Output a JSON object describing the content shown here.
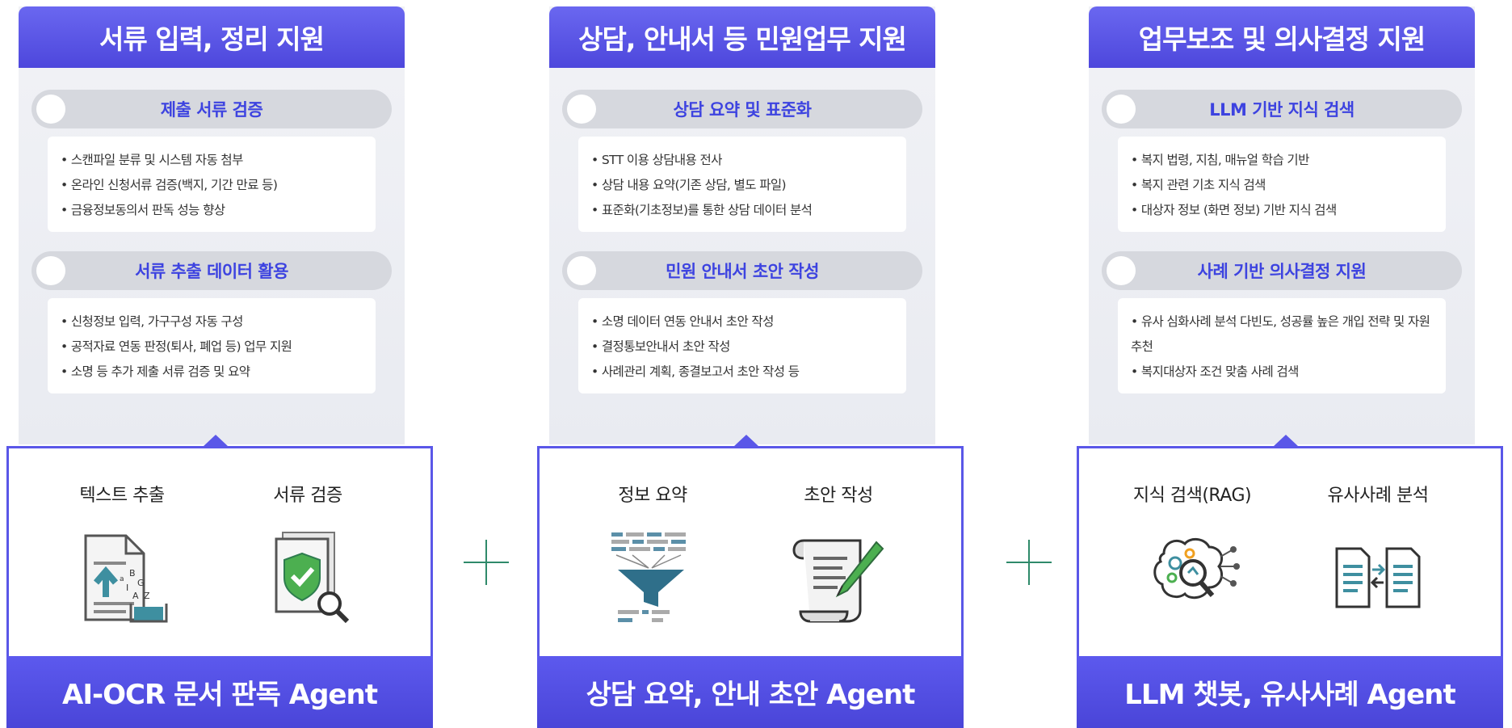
{
  "columns": [
    {
      "top_title": "서류 입력, 정리 지원",
      "sections": [
        {
          "title": "제출 서류 검증",
          "bullets": [
            "스캔파일 분류 및 시스템 자동 첨부",
            "온라인 신청서류 검증(백지, 기간 만료 등)",
            "금융정보동의서 판독 성능 향상"
          ]
        },
        {
          "title": "서류 추출 데이터 활용",
          "bullets": [
            "신청정보 입력, 가구구성 자동 구성",
            "공적자료 연동 판정(퇴사, 폐업 등) 업무 지원",
            "소명 등 추가 제출 서류 검증 및 요약"
          ]
        }
      ],
      "tools": [
        {
          "label": "텍스트 추출",
          "icon": "document-upload-icon"
        },
        {
          "label": "서류 검증",
          "icon": "document-verify-icon"
        }
      ],
      "bottom_title": "AI-OCR 문서 판독 Agent"
    },
    {
      "top_title": "상담, 안내서 등 민원업무 지원",
      "sections": [
        {
          "title": "상담 요약 및 표준화",
          "bullets": [
            "STT 이용 상담내용 전사",
            "상담 내용 요약(기존 상담, 별도 파일)",
            "표준화(기초정보)를 통한 상담 데이터 분석"
          ]
        },
        {
          "title": "민원 안내서 초안 작성",
          "bullets": [
            "소명 데이터 연동 안내서 초안 작성",
            "결정통보안내서 초안 작성",
            "사례관리 계획, 종결보고서 초안 작성 등"
          ]
        }
      ],
      "tools": [
        {
          "label": "정보 요약",
          "icon": "funnel-summary-icon"
        },
        {
          "label": "초안 작성",
          "icon": "scroll-pen-icon"
        }
      ],
      "bottom_title": "상담 요약, 안내 초안 Agent"
    },
    {
      "top_title": "업무보조 및 의사결정 지원",
      "sections": [
        {
          "title": "LLM 기반 지식 검색",
          "bullets": [
            "복지 법령, 지침, 매뉴얼 학습 기반",
            "복지 관련 기초 지식 검색",
            "대상자 정보 (화면 정보) 기반 지식 검색"
          ]
        },
        {
          "title": "사례 기반 의사결정 지원",
          "bullets": [
            "유사 심화사례 분석 다빈도, 성공률 높은 개입 전략 및 자원 추천",
            "복지대상자 조건 맞춤 사례 검색"
          ]
        }
      ],
      "tools": [
        {
          "label": "지식 검색(RAG)",
          "icon": "brain-search-icon"
        },
        {
          "label": "유사사례 분석",
          "icon": "document-compare-icon"
        }
      ],
      "bottom_title": "LLM 챗봇, 유사사례 Agent"
    }
  ],
  "colors": {
    "accent": "#4d47dc",
    "pill_text": "#3d43e0",
    "plus": "#2f8a6a",
    "icon_teal": "#3e8fa0",
    "icon_green": "#4caf50"
  }
}
